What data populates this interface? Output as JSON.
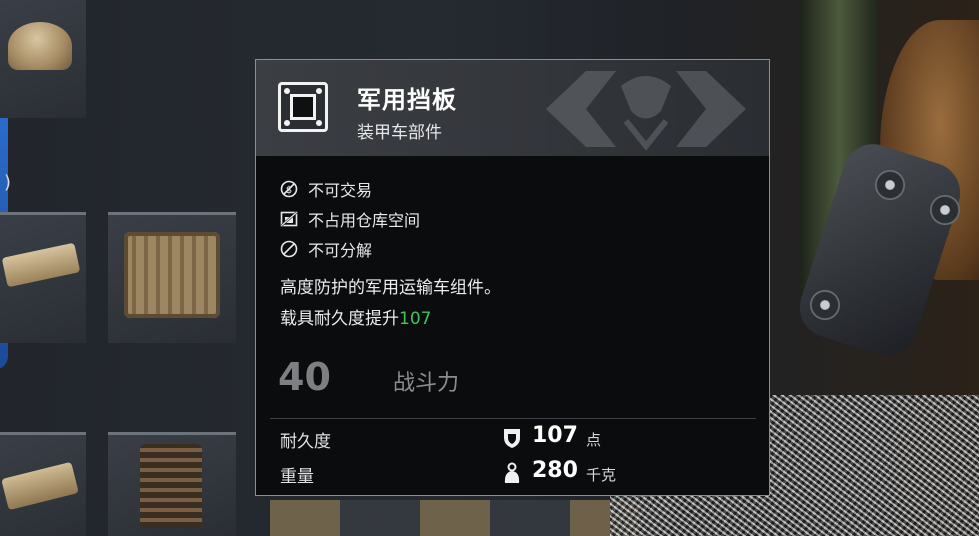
{
  "inventory": {
    "partial_label": ")"
  },
  "tooltip": {
    "item_name": "军用挡板",
    "item_category": "装甲车部件",
    "item_icon": "armor-plate-icon",
    "traits": [
      {
        "icon": "no-trade-icon",
        "label": "不可交易"
      },
      {
        "icon": "no-storage-icon",
        "label": "不占用仓库空间"
      },
      {
        "icon": "no-dismantle-icon",
        "label": "不可分解"
      }
    ],
    "description": "高度防护的军用运输车组件。",
    "effect_prefix": "载具耐久度提升",
    "effect_value": "107",
    "power_value": "40",
    "power_label": "战斗力",
    "stats": [
      {
        "label": "耐久度",
        "icon": "shield-icon",
        "value": "107",
        "unit": "点"
      },
      {
        "label": "重量",
        "icon": "weight-icon",
        "value": "280",
        "unit": "千克"
      }
    ]
  },
  "colors": {
    "accent_green": "#45c05a",
    "panel_bg": "#0b0c0e",
    "header_bg": "#3b3e43"
  }
}
